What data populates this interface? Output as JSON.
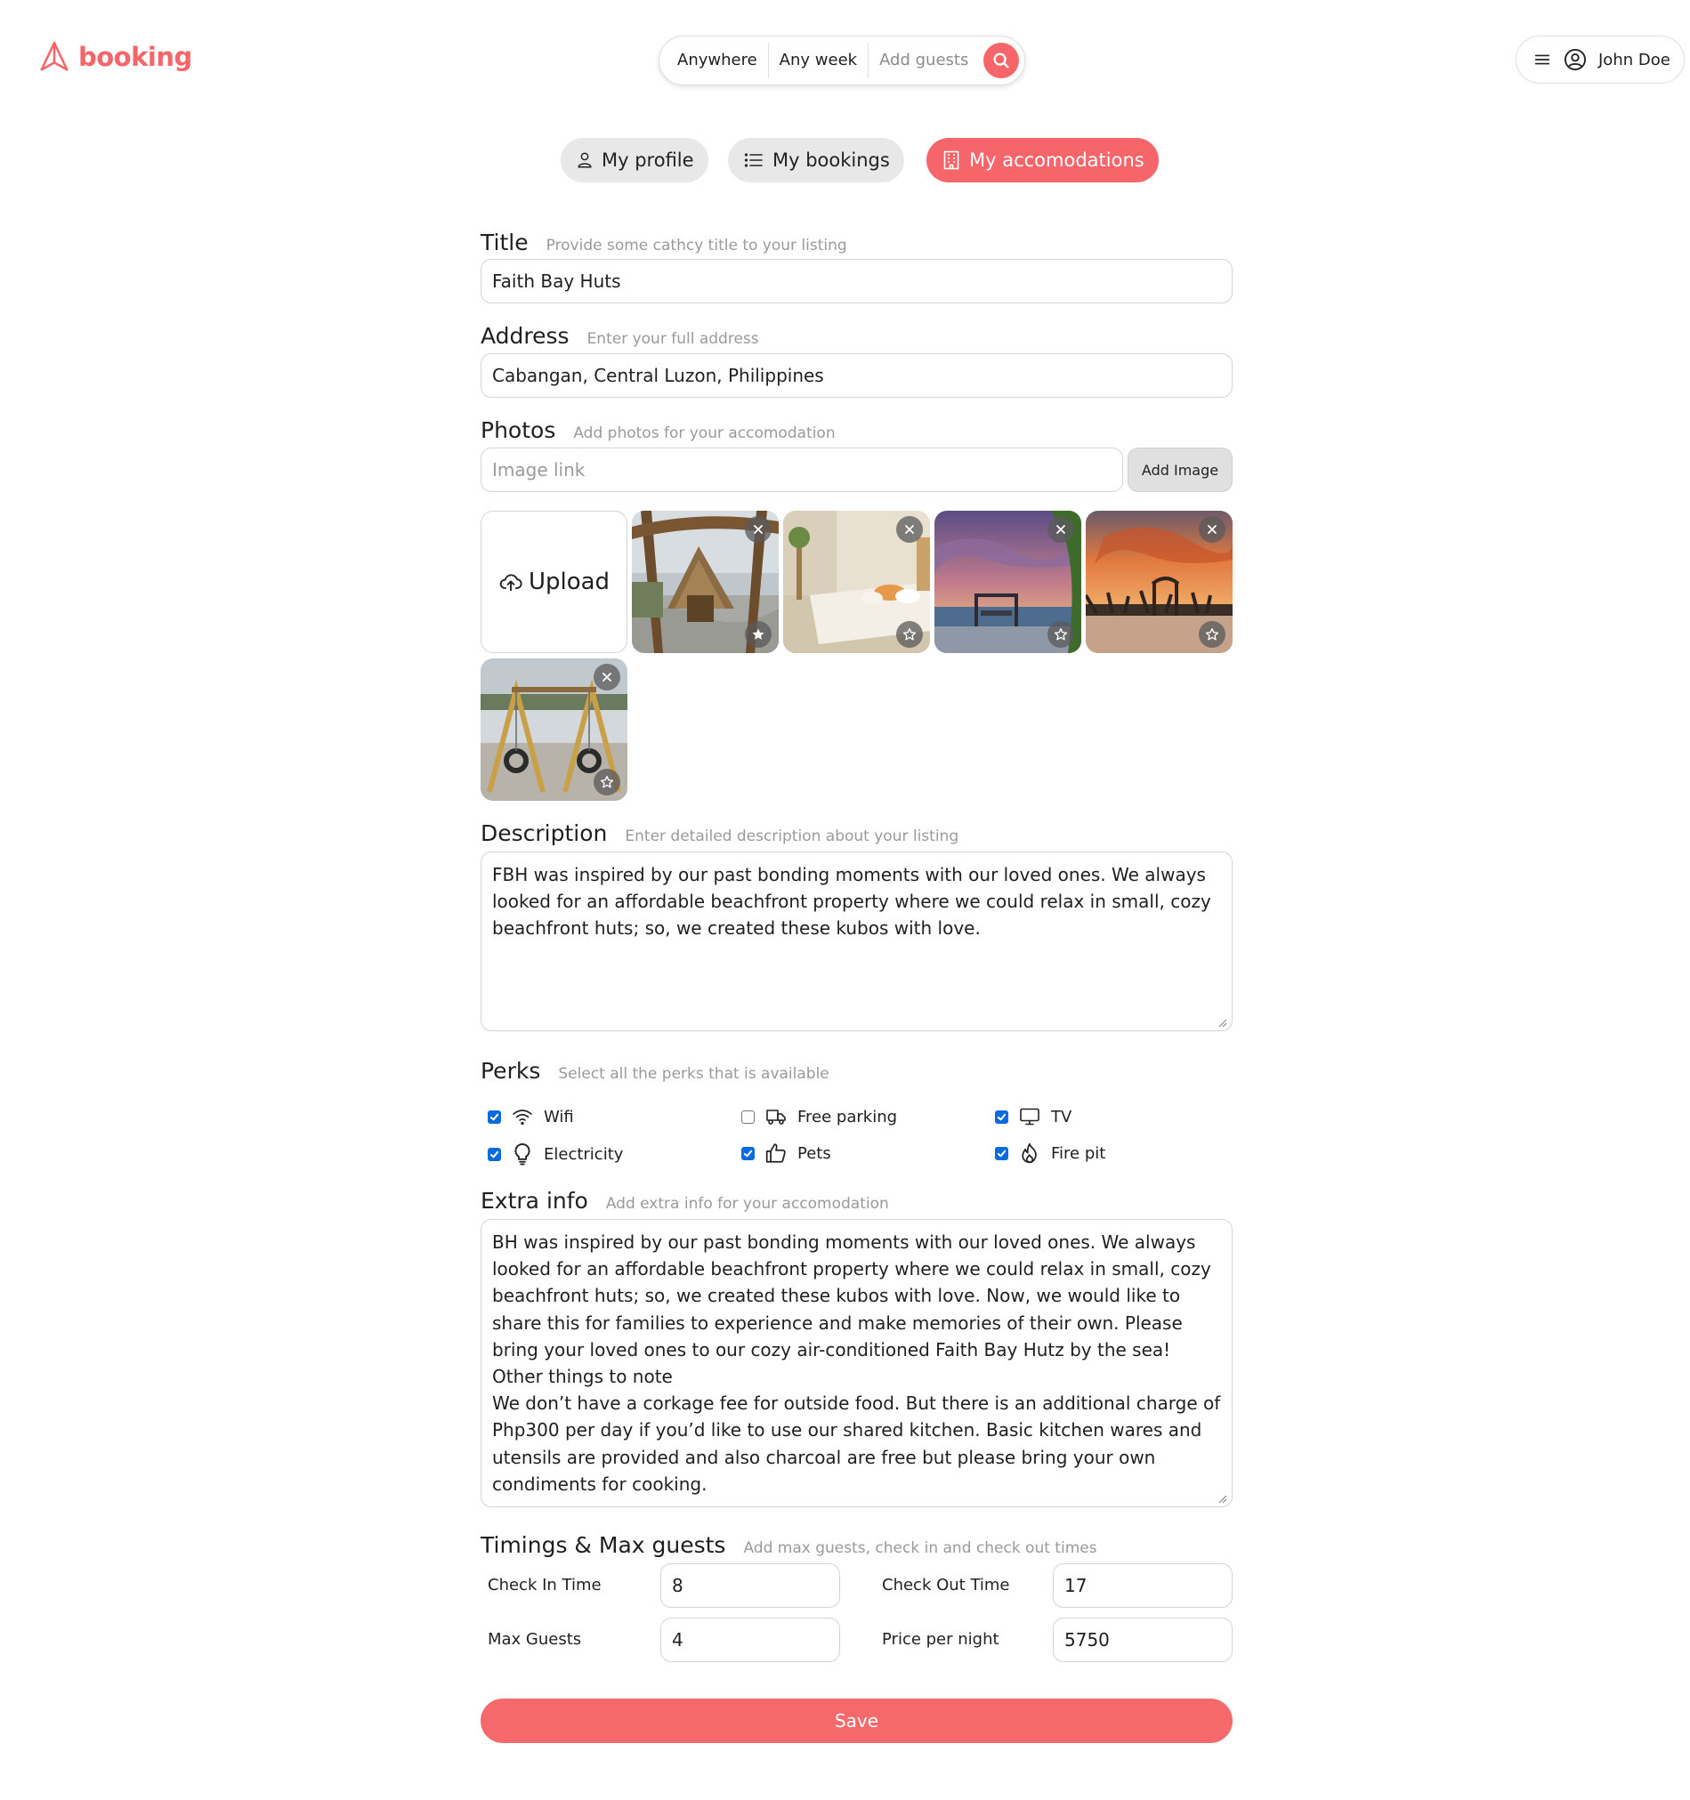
{
  "brand": {
    "name": "booking",
    "logo_icon": "paper-plane-icon",
    "accent": "#f5656a"
  },
  "search": {
    "where": "Anywhere",
    "when": "Any week",
    "guests": "Add guests",
    "icon": "search-icon"
  },
  "user": {
    "name": "John Doe",
    "menu_icon": "hamburger-icon",
    "avatar_icon": "user-circle-icon"
  },
  "tabs": [
    {
      "label": "My profile",
      "icon": "user-icon",
      "active": false
    },
    {
      "label": "My bookings",
      "icon": "list-icon",
      "active": false
    },
    {
      "label": "My accomodations",
      "icon": "building-icon",
      "active": true
    }
  ],
  "form": {
    "title": {
      "label": "Title",
      "hint": "Provide some cathcy title to your listing",
      "value": "Faith Bay Huts"
    },
    "address": {
      "label": "Address",
      "hint": "Enter your full address",
      "value": "Cabangan, Central Luzon, Philippines"
    },
    "photos": {
      "label": "Photos",
      "hint": "Add photos for your accomodation",
      "link_placeholder": "Image link",
      "add_button": "Add Image",
      "upload_label": "Upload",
      "items": [
        {
          "subject": "thatched hut entrance arch",
          "main": true
        },
        {
          "subject": "bedroom interior",
          "main": false
        },
        {
          "subject": "beach at sunset with swing",
          "main": false
        },
        {
          "subject": "beach sunset with fence",
          "main": false
        },
        {
          "subject": "swings on sand",
          "main": false
        }
      ]
    },
    "description": {
      "label": "Description",
      "hint": "Enter detailed description about your listing",
      "value": "FBH was inspired by our past bonding moments with our loved ones. We always looked for an affordable beachfront property where we could relax in small, cozy beachfront huts; so, we created these kubos with love."
    },
    "perks": {
      "label": "Perks",
      "hint": "Select all the perks that is available",
      "items": [
        {
          "label": "Wifi",
          "icon": "wifi-icon",
          "checked": true
        },
        {
          "label": "Free parking",
          "icon": "truck-icon",
          "checked": false
        },
        {
          "label": "TV",
          "icon": "tv-icon",
          "checked": true
        },
        {
          "label": "Electricity",
          "icon": "lightbulb-icon",
          "checked": true
        },
        {
          "label": "Pets",
          "icon": "thumbs-up-icon",
          "checked": true
        },
        {
          "label": "Fire pit",
          "icon": "fire-icon",
          "checked": true
        }
      ]
    },
    "extra_info": {
      "label": "Extra info",
      "hint": "Add extra info for your accomodation",
      "value": "BH was inspired by our past bonding moments with our loved ones. We always looked for an affordable beachfront property where we could relax in small, cozy beachfront huts; so, we created these kubos with love. Now, we would like to share this for families to experience and make memories of their own. Please bring your loved ones to our cozy air-conditioned Faith Bay Hutz by the sea!\nOther things to note\nWe don’t have a corkage fee for outside food. But there is an additional charge of Php300 per day if you’d like to use our shared kitchen. Basic kitchen wares and utensils are provided and also charcoal are free but please bring your own condiments for cooking."
    },
    "timings": {
      "label": "Timings & Max guests",
      "hint": "Add max guests, check in and check out times",
      "check_in_label": "Check In Time",
      "check_in": "8",
      "check_out_label": "Check Out Time",
      "check_out": "17",
      "max_guests_label": "Max Guests",
      "max_guests": "4",
      "price_label": "Price per night",
      "price": "5750"
    },
    "save_label": "Save"
  }
}
